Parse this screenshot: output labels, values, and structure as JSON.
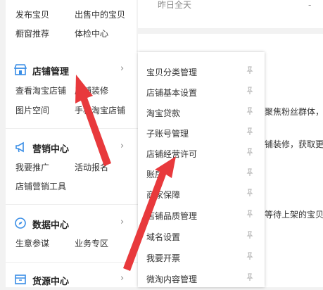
{
  "left_menu": {
    "top_rows": [
      [
        "发布宝贝",
        "出售中的宝贝"
      ],
      [
        "橱窗推荐",
        "体检中心"
      ]
    ],
    "sections": [
      {
        "title": "店铺管理",
        "icon": "store-icon",
        "items": [
          [
            "查看淘宝店铺",
            "店铺装修"
          ],
          [
            "图片空间",
            "手机淘宝店铺"
          ]
        ]
      },
      {
        "title": "营销中心",
        "icon": "megaphone-icon",
        "items": [
          [
            "我要推广",
            "活动报名"
          ],
          [
            "店铺营销工具",
            ""
          ]
        ]
      },
      {
        "title": "数据中心",
        "icon": "compass-icon",
        "items": [
          [
            "生意参谋",
            "业务专区"
          ]
        ]
      },
      {
        "title": "货源中心",
        "icon": "box-icon",
        "items": []
      }
    ]
  },
  "background": {
    "yesterday_label": "昨日全天",
    "dash": "-",
    "partial_1": "聚焦粉丝群体，",
    "partial_2": "铺装修，获取更多",
    "partial_3": "，等待上架的宝贝"
  },
  "popup_menu": {
    "items": [
      "宝贝分类管理",
      "店铺基本设置",
      "淘宝贷款",
      "子账号管理",
      "店铺经营许可",
      "账房",
      "商家保障",
      "店铺品质管理",
      "域名设置",
      "我要开票",
      "微淘内容管理"
    ]
  },
  "colors": {
    "accent": "#ff5000",
    "arrow": "#e8393c",
    "section_icon": "#3a8ee6"
  }
}
